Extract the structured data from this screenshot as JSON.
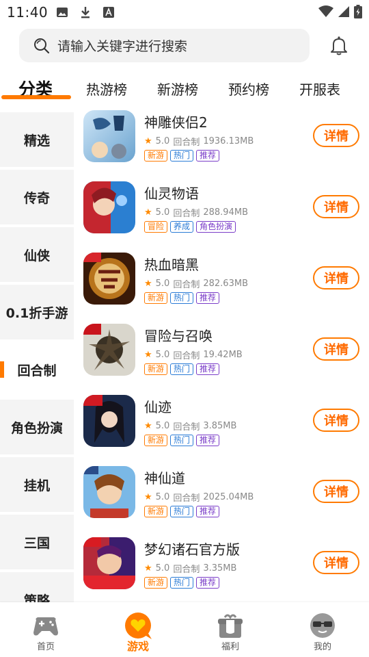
{
  "status_bar": {
    "time": "11:40"
  },
  "search": {
    "placeholder": "请输入关键字进行搜索"
  },
  "tabs": [
    {
      "label": "分类"
    },
    {
      "label": "热游榜"
    },
    {
      "label": "新游榜"
    },
    {
      "label": "预约榜"
    },
    {
      "label": "开服表"
    }
  ],
  "sidebar": {
    "items": [
      {
        "label": "精选"
      },
      {
        "label": "传奇"
      },
      {
        "label": "仙侠"
      },
      {
        "label": "0.1折手游"
      },
      {
        "label": "回合制"
      },
      {
        "label": "角色扮演"
      },
      {
        "label": "挂机"
      },
      {
        "label": "三国"
      },
      {
        "label": "策略"
      }
    ],
    "active_label": "回合制"
  },
  "games": [
    {
      "name": "神雕侠侣2",
      "rating": "5.0",
      "type": "回合制",
      "size": "1936.13MB",
      "tags": [
        "新游",
        "热门",
        "推荐"
      ],
      "button": "详情"
    },
    {
      "name": "仙灵物语",
      "rating": "5.0",
      "type": "回合制",
      "size": "288.94MB",
      "tags": [
        "冒险",
        "养成",
        "角色扮演"
      ],
      "button": "详情"
    },
    {
      "name": "热血暗黑",
      "rating": "5.0",
      "type": "回合制",
      "size": "282.63MB",
      "tags": [
        "新游",
        "热门",
        "推荐"
      ],
      "button": "详情"
    },
    {
      "name": "冒险与召唤",
      "rating": "5.0",
      "type": "回合制",
      "size": "19.42MB",
      "tags": [
        "新游",
        "热门",
        "推荐"
      ],
      "button": "详情"
    },
    {
      "name": "仙迹",
      "rating": "5.0",
      "type": "回合制",
      "size": "3.85MB",
      "tags": [
        "新游",
        "热门",
        "推荐"
      ],
      "button": "详情"
    },
    {
      "name": "神仙道",
      "rating": "5.0",
      "type": "回合制",
      "size": "2025.04MB",
      "tags": [
        "新游",
        "热门",
        "推荐"
      ],
      "button": "详情"
    },
    {
      "name": "梦幻诸石官方版",
      "rating": "5.0",
      "type": "回合制",
      "size": "3.35MB",
      "tags": [
        "新游",
        "热门",
        "推荐"
      ],
      "button": "详情"
    }
  ],
  "bottom_nav": [
    {
      "label": "首页",
      "icon": "gamepad-icon"
    },
    {
      "label": "游戏",
      "icon": "heart-bubble-icon"
    },
    {
      "label": "福利",
      "icon": "gift-icon"
    },
    {
      "label": "我的",
      "icon": "sunglasses-face-icon"
    }
  ],
  "colors": {
    "accent": "#ff7a00",
    "tag_blue": "#2a7bd6",
    "tag_purple": "#7a3cc8"
  }
}
